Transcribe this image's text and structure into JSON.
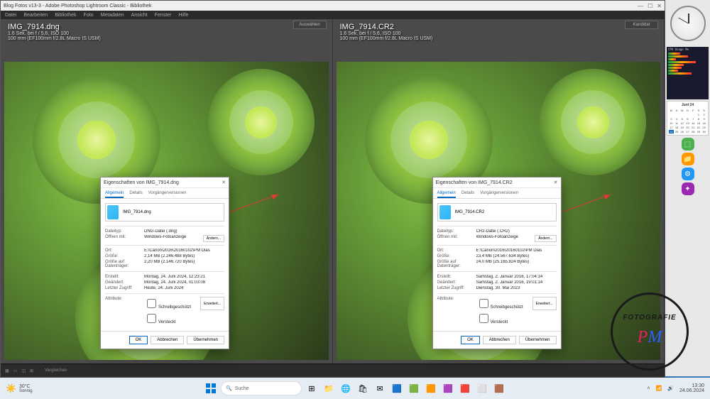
{
  "window": {
    "title": "Blog Fotos v13-3 - Adobe Photoshop Lightroom Classic - Bibliothek",
    "menu": [
      "Datei",
      "Bearbeiten",
      "Bibliothek",
      "Foto",
      "Metadaten",
      "Ansicht",
      "Fenster",
      "Hilfe"
    ]
  },
  "left": {
    "filename": "IMG_7914.dng",
    "meta1": "1.6 Sek. bei f / 5,6, ISO 100",
    "meta2": "100 mm (EF100mm f/2.8L Macro IS USM)",
    "select": "Auswählen",
    "dialog": {
      "title": "Eigenschaften von IMG_7914.dng",
      "tabs": [
        "Allgemein",
        "Details",
        "Vorgängerversionen"
      ],
      "filename": "IMG_7914.dng",
      "rows": [
        {
          "k": "Dateityp:",
          "v": "DNG-Datei (.dng)"
        },
        {
          "k": "Öffnen mit:",
          "v": "Windows-Fotoanzeige"
        },
        {
          "k": "Ort:",
          "v": "E:\\Canon\\2016\\20160102\\PM Dias"
        },
        {
          "k": "Größe:",
          "v": "2,14 MB (2.246.488 Bytes)"
        },
        {
          "k": "Größe auf Datenträger:",
          "v": "2,20 MB (2.146.720 Bytes)"
        },
        {
          "k": "Erstellt:",
          "v": "Montag, 24. Juni 2024, 12:23:21"
        },
        {
          "k": "Geändert:",
          "v": "Montag, 24. Juni 2024, 01:03:08"
        },
        {
          "k": "Letzter Zugriff:",
          "v": "Heute, 24. Juni 2024"
        }
      ],
      "attr_label": "Attribute:",
      "attrs": [
        "Schreibgeschützt",
        "Versteckt"
      ],
      "change": "Ändern...",
      "adv": "Erweitert...",
      "ok": "OK",
      "cancel": "Abbrechen",
      "apply": "Übernehmen"
    }
  },
  "right": {
    "filename": "IMG_7914.CR2",
    "meta1": "1.6 Sek. bei f / 5,6, ISO 100",
    "meta2": "100 mm (EF100mm f/2.8L Macro IS USM)",
    "select": "Kandidat",
    "dialog": {
      "title": "Eigenschaften von IMG_7914.CR2",
      "tabs": [
        "Allgemein",
        "Details",
        "Vorgängerversionen"
      ],
      "filename": "IMG_7914.CR2",
      "rows": [
        {
          "k": "Dateityp:",
          "v": "CR2-Datei (.CR2)"
        },
        {
          "k": "Öffnen mit:",
          "v": "Windows-Fotoanzeige"
        },
        {
          "k": "Ort:",
          "v": "E:\\Canon\\2016\\20160102\\PM Dias"
        },
        {
          "k": "Größe:",
          "v": "23,4 MB (24.567.634 Bytes)"
        },
        {
          "k": "Größe auf Datenträger:",
          "v": "24,0 MB (25.165.824 Bytes)"
        },
        {
          "k": "Erstellt:",
          "v": "Samstag, 2. Januar 2016, 17:04:14"
        },
        {
          "k": "Geändert:",
          "v": "Samstag, 2. Januar 2016, 19:01:14"
        },
        {
          "k": "Letzter Zugriff:",
          "v": "Dienstag, 30. Mai 2023"
        }
      ],
      "attr_label": "Attribute:",
      "attrs": [
        "Schreibgeschützt",
        "Versteckt"
      ],
      "change": "Ändern...",
      "adv": "Erweitert...",
      "ok": "OK",
      "cancel": "Abbrechen",
      "apply": "Übernehmen"
    }
  },
  "bottom": {
    "label": "Vergleichen"
  },
  "calendar": {
    "head": "Juni 24"
  },
  "cpu": {
    "title": "CPU Usage  9%"
  },
  "taskbar": {
    "weather_temp": "30°C",
    "weather_cond": "Sonnig",
    "search": "Suche",
    "time": "13:30",
    "date": "24.06.2024"
  },
  "logo": {
    "line1": "FOTOGRAFIE",
    "p": "P",
    "m": "M"
  }
}
